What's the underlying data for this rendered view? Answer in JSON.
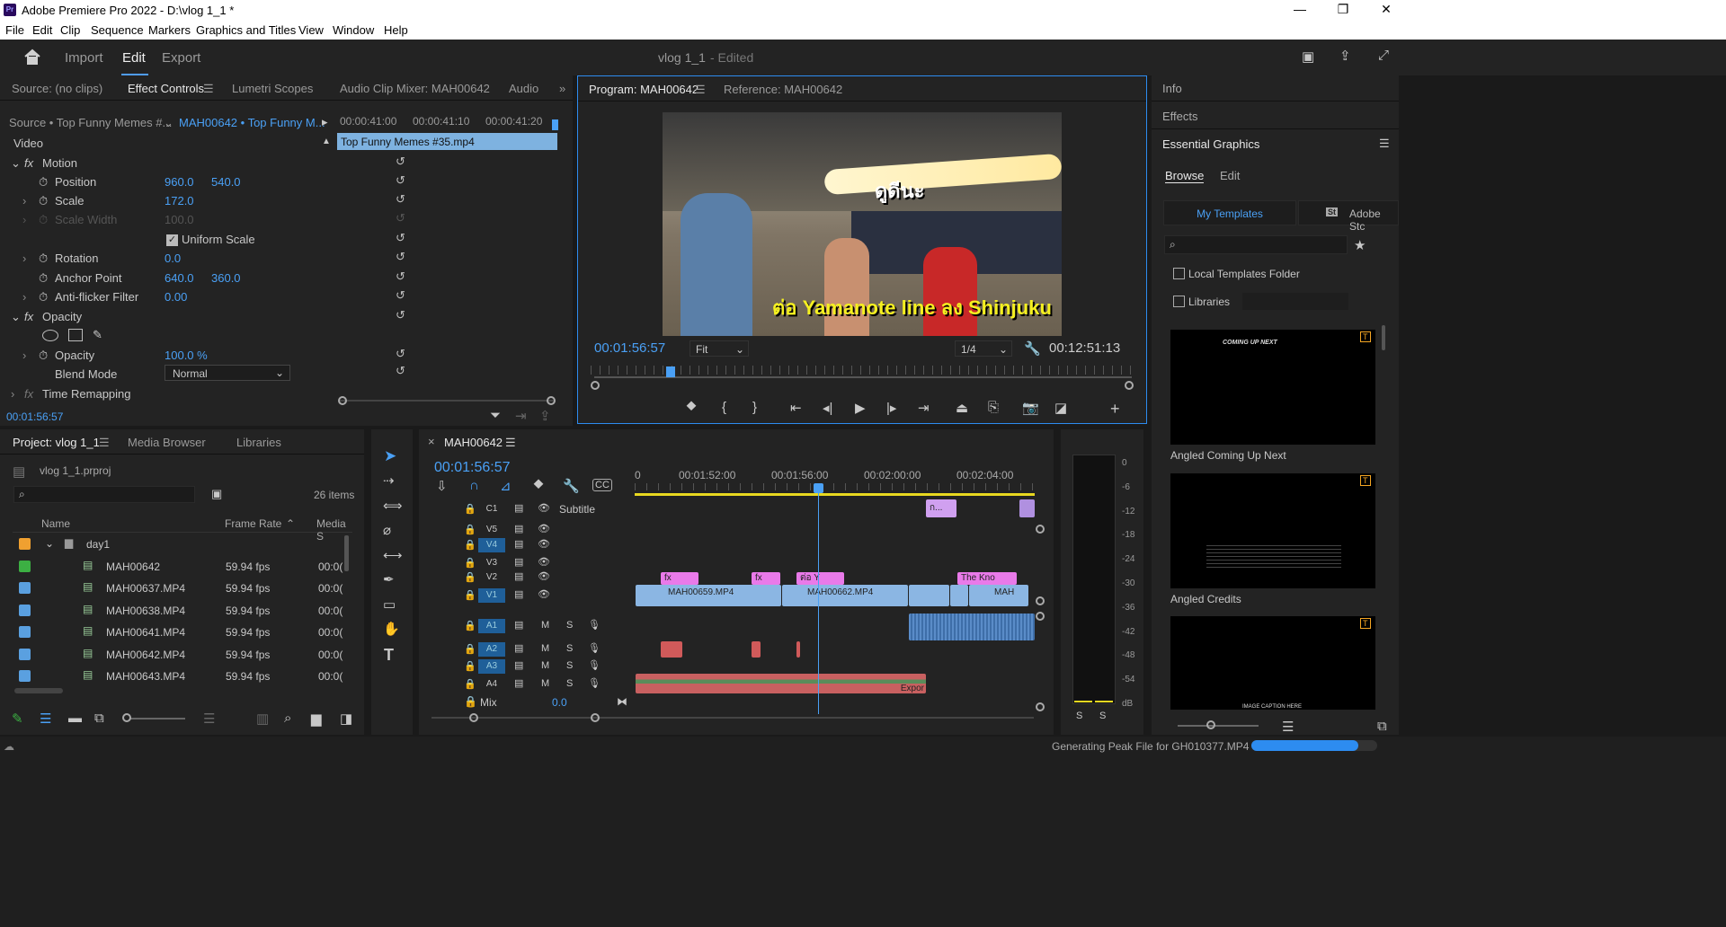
{
  "app": {
    "title": "Adobe Premiere Pro 2022 - D:\\vlog 1_1 *",
    "logo": "Pr",
    "win_controls": [
      "—",
      "❐",
      "✕"
    ]
  },
  "menu": [
    "File",
    "Edit",
    "Clip",
    "Sequence",
    "Markers",
    "Graphics and Titles",
    "View",
    "Window",
    "Help"
  ],
  "workspace": {
    "tabs": [
      "Import",
      "Edit",
      "Export"
    ],
    "active": "Edit",
    "project": "vlog 1_1",
    "status": "- Edited"
  },
  "source_panel": {
    "tabs": [
      "Source: (no clips)",
      "Effect Controls",
      "Lumetri Scopes",
      "Audio Clip Mixer: MAH00642",
      "Audio"
    ],
    "active": "Effect Controls",
    "master": "Source • Top Funny Memes #...",
    "clip": "MAH00642 • Top Funny M...",
    "ruler": [
      "00:00:41:00",
      "00:00:41:10",
      "00:00:41:20"
    ],
    "clip_bar": "Top Funny Memes #35.mp4",
    "section": "Video",
    "props": [
      {
        "name": "Motion",
        "fx": true
      },
      {
        "name": "Position",
        "v1": "960.0",
        "v2": "540.0"
      },
      {
        "name": "Scale",
        "v1": "172.0"
      },
      {
        "name": "Scale Width",
        "v1": "100.0",
        "disabled": true
      },
      {
        "name": "Uniform Scale",
        "checkbox": true
      },
      {
        "name": "Rotation",
        "v1": "0.0"
      },
      {
        "name": "Anchor Point",
        "v1": "640.0",
        "v2": "360.0"
      },
      {
        "name": "Anti-flicker Filter",
        "v1": "0.00"
      },
      {
        "name": "Opacity",
        "fx": true
      },
      {
        "name": "Opacity",
        "v1": "100.0 %"
      },
      {
        "name": "Blend Mode",
        "select": "Normal"
      },
      {
        "name": "Time Remapping",
        "fx": true
      }
    ],
    "timecode": "00:01:56:57"
  },
  "program": {
    "tabs": [
      "Program: MAH00642",
      "Reference: MAH00642"
    ],
    "subtitle_top": "ดูดีนะ",
    "subtitle_bottom": "ต่อ Yamanote line ลง Shinjuku",
    "timecode": "00:01:56:57",
    "fit": "Fit",
    "res": "1/4",
    "duration": "00:12:51:13"
  },
  "project": {
    "tabs": [
      "Project: vlog 1_1",
      "Media Browser",
      "Libraries"
    ],
    "file": "vlog 1_1.prproj",
    "count": "26 items",
    "columns": [
      "Name",
      "Frame Rate",
      "Media S"
    ],
    "items": [
      {
        "name": "day1",
        "rate": "",
        "media": "",
        "color": "#f0a030",
        "folder": true
      },
      {
        "name": "MAH00642",
        "rate": "59.94 fps",
        "media": "00:0(",
        "color": "#3cb043"
      },
      {
        "name": "MAH00637.MP4",
        "rate": "59.94 fps",
        "media": "00:0(",
        "color": "#5aa0e0"
      },
      {
        "name": "MAH00638.MP4",
        "rate": "59.94 fps",
        "media": "00:0(",
        "color": "#5aa0e0"
      },
      {
        "name": "MAH00641.MP4",
        "rate": "59.94 fps",
        "media": "00:0(",
        "color": "#5aa0e0"
      },
      {
        "name": "MAH00642.MP4",
        "rate": "59.94 fps",
        "media": "00:0(",
        "color": "#5aa0e0"
      },
      {
        "name": "MAH00643.MP4",
        "rate": "59.94 fps",
        "media": "00:0(",
        "color": "#5aa0e0"
      }
    ]
  },
  "timeline": {
    "tab": "MAH00642",
    "timecode": "00:01:56:57",
    "ruler": [
      "0",
      "00:01:52:00",
      "00:01:56:00",
      "00:02:00:00",
      "00:02:04:00"
    ],
    "tracks": {
      "c1": "C1",
      "subtitle": "Subtitle",
      "v5": "V5",
      "v4": "V4",
      "v3": "V3",
      "v2": "V2",
      "v1": "V1",
      "a1": "A1",
      "a2": "A2",
      "a3": "A3",
      "a4": "A4",
      "mix": "Mix",
      "mix_val": "0.0",
      "m": "M",
      "s": "S"
    },
    "clips": {
      "sub1": "ก...",
      "v2a": "ต่อ Y",
      "v2b": "The Kno",
      "v1a": "MAH00659.MP4",
      "v1b": "MAH00662.MP4",
      "v1c": "MAH",
      "a4": "Expor",
      "fx": "fx"
    }
  },
  "meter": {
    "scale": [
      "0",
      "-6",
      "-12",
      "-18",
      "-24",
      "-30",
      "-36",
      "-42",
      "-48",
      "-54",
      "dB"
    ],
    "solo": [
      "S",
      "S"
    ]
  },
  "right": {
    "tabs": [
      "Info",
      "Effects",
      "Essential Graphics"
    ],
    "sub_tabs": [
      "Browse",
      "Edit"
    ],
    "buttons": [
      "My Templates",
      "Adobe Stc"
    ],
    "local": "Local Templates Folder",
    "libraries": "Libraries",
    "templates": [
      {
        "name": "Angled Coming Up Next",
        "thumb": "COMING UP NEXT"
      },
      {
        "name": "Angled Credits",
        "thumb": ""
      },
      {
        "name": "",
        "thumb": "IMAGE CAPTION HERE"
      }
    ]
  },
  "status": {
    "text": "Generating Peak File for GH010377.MP4",
    "progress": 0.85
  }
}
